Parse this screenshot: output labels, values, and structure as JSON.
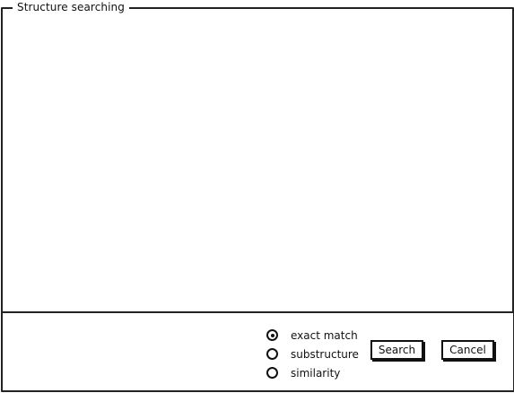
{
  "panel": {
    "title": "Structure searching"
  },
  "search_mode": {
    "options": [
      {
        "label": "exact match",
        "selected": true
      },
      {
        "label": "substructure",
        "selected": false
      },
      {
        "label": "similarity",
        "selected": false
      }
    ]
  },
  "actions": {
    "search_label": "Search",
    "cancel_label": "Cancel"
  }
}
